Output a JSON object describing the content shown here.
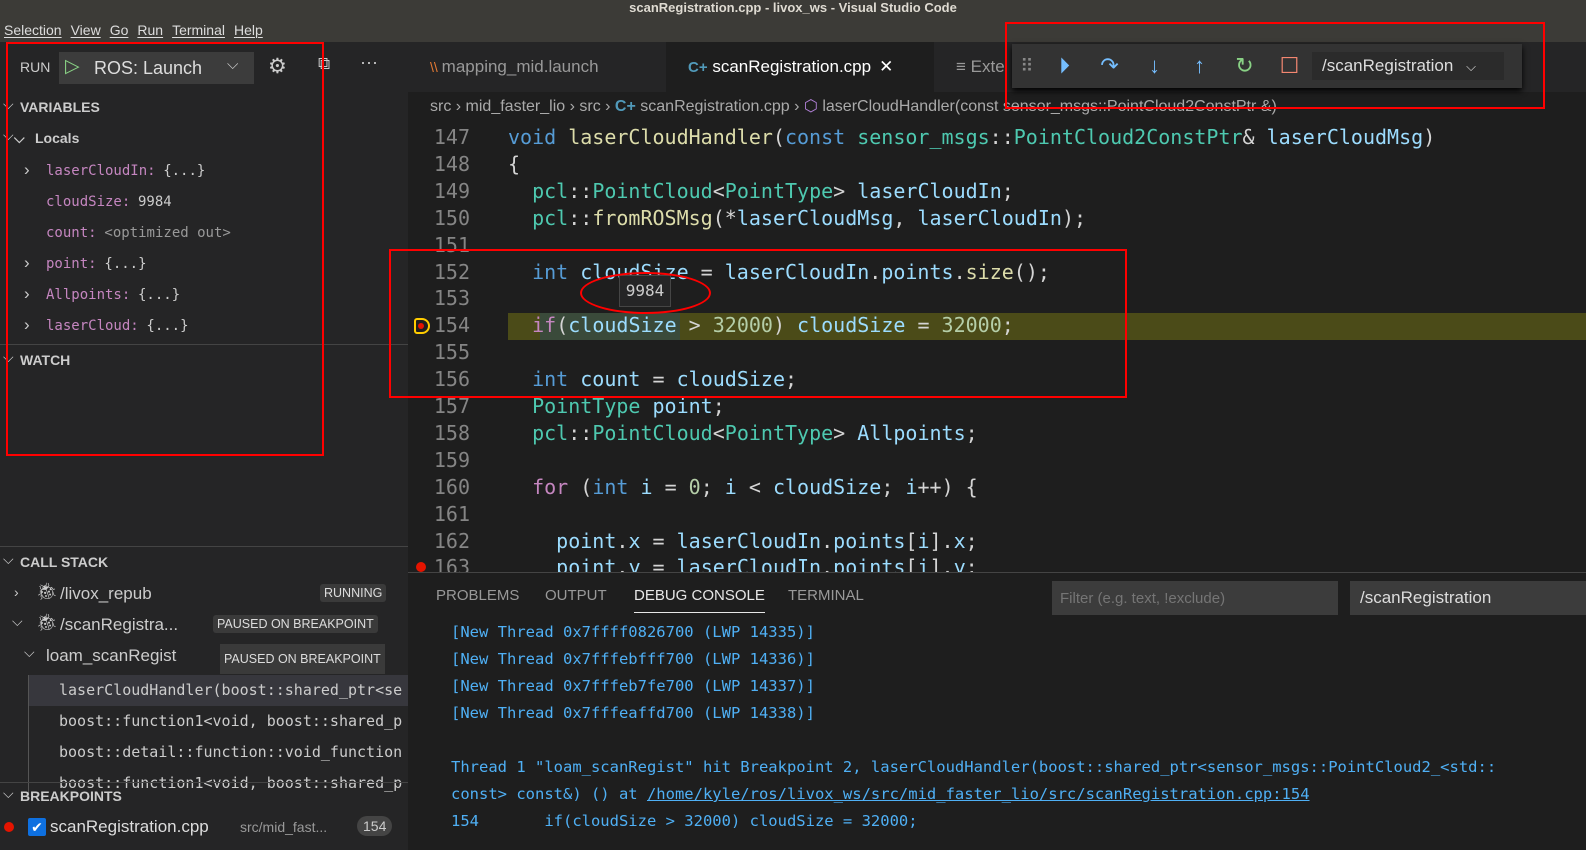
{
  "window": {
    "title": "scanRegistration.cpp - livox_ws - Visual Studio Code"
  },
  "menu": [
    "Selection",
    "View",
    "Go",
    "Run",
    "Terminal",
    "Help"
  ],
  "run": {
    "label": "RUN",
    "config": "ROS: Launch"
  },
  "variables": {
    "title": "VARIABLES",
    "scope": "Locals",
    "items": [
      {
        "name": "laserCloudIn:",
        "value": "{...}",
        "expandable": true
      },
      {
        "name": "cloudSize:",
        "value": "9984",
        "expandable": false
      },
      {
        "name": "count:",
        "value": "<optimized out>",
        "expandable": false
      },
      {
        "name": "point:",
        "value": "{...}",
        "expandable": true
      },
      {
        "name": "Allpoints:",
        "value": "{...}",
        "expandable": true
      },
      {
        "name": "laserCloud:",
        "value": "{...}",
        "expandable": true
      }
    ]
  },
  "watch": {
    "title": "WATCH"
  },
  "callstack": {
    "title": "CALL STACK",
    "processes": [
      {
        "name": "/livox_repub",
        "status": "RUNNING"
      },
      {
        "name": "/scanRegistra...",
        "status": "PAUSED ON BREAKPOINT"
      }
    ],
    "thread": {
      "name": "loam_scanRegist",
      "status": "PAUSED ON BREAKPOINT"
    },
    "frames": [
      "laserCloudHandler(boost::shared_ptr<se",
      "boost::function1<void, boost::shared_p",
      "boost::detail::function::void_function",
      "boost::function1<void, boost::shared_p"
    ]
  },
  "breakpoints": {
    "title": "BREAKPOINTS",
    "items": [
      {
        "file": "scanRegistration.cpp",
        "path": "src/mid_fast...",
        "line": "154",
        "checked": true
      }
    ]
  },
  "tabs": [
    {
      "label": "mapping_mid.launch",
      "icon": "rss-icon"
    },
    {
      "label": "scanRegistration.cpp",
      "icon": "cpp-icon",
      "active": true
    },
    {
      "label": "Exte",
      "icon": "list-icon"
    }
  ],
  "debug_toolbar": {
    "buttons": [
      "continue",
      "step-over",
      "step-into",
      "step-out",
      "restart",
      "stop"
    ],
    "session": "/scanRegistration"
  },
  "breadcrumb": [
    "src",
    "mid_faster_lio",
    "src",
    "scanRegistration.cpp",
    "laserCloudHandler(const sensor_msgs::PointCloud2ConstPtr &)"
  ],
  "hover_value": "9984",
  "current_line": "154",
  "code": [
    {
      "n": "147",
      "t": [
        [
          "kw",
          "void "
        ],
        [
          "fn",
          "laserCloudHandler"
        ],
        [
          "pl",
          "("
        ],
        [
          "kw",
          "const "
        ],
        [
          "ty",
          "sensor_msgs"
        ],
        [
          "pl",
          "::"
        ],
        [
          "ty",
          "PointCloud2ConstPtr"
        ],
        [
          "pl",
          "& "
        ],
        [
          "va",
          "laserCloudMsg"
        ],
        [
          "pl",
          ")"
        ]
      ]
    },
    {
      "n": "148",
      "t": [
        [
          "pl",
          "{"
        ]
      ]
    },
    {
      "n": "149",
      "t": [
        [
          "pl",
          "  "
        ],
        [
          "ty",
          "pcl"
        ],
        [
          "pl",
          "::"
        ],
        [
          "ty",
          "PointCloud"
        ],
        [
          "pl",
          "<"
        ],
        [
          "ty",
          "PointType"
        ],
        [
          "pl",
          "> "
        ],
        [
          "va",
          "laserCloudIn"
        ],
        [
          "pl",
          ";"
        ]
      ]
    },
    {
      "n": "150",
      "t": [
        [
          "pl",
          "  "
        ],
        [
          "ty",
          "pcl"
        ],
        [
          "pl",
          "::"
        ],
        [
          "fn",
          "fromROSMsg"
        ],
        [
          "pl",
          "(*"
        ],
        [
          "va",
          "laserCloudMsg"
        ],
        [
          "pl",
          ", "
        ],
        [
          "va",
          "laserCloudIn"
        ],
        [
          "pl",
          ");"
        ]
      ]
    },
    {
      "n": "151",
      "t": []
    },
    {
      "n": "152",
      "t": [
        [
          "pl",
          "  "
        ],
        [
          "kw",
          "int "
        ],
        [
          "va",
          "cloudSize"
        ],
        [
          "pl",
          " = "
        ],
        [
          "va",
          "laserCloudIn"
        ],
        [
          "pl",
          "."
        ],
        [
          "va",
          "points"
        ],
        [
          "pl",
          "."
        ],
        [
          "fn",
          "size"
        ],
        [
          "pl",
          "();"
        ]
      ]
    },
    {
      "n": "153",
      "t": []
    },
    {
      "n": "154",
      "t": [
        [
          "pl",
          "  "
        ],
        [
          "ct",
          "if"
        ],
        [
          "pl",
          "("
        ],
        [
          "va",
          "cloudSize"
        ],
        [
          "pl",
          " > "
        ],
        [
          "nu",
          "32000"
        ],
        [
          "pl",
          ") "
        ],
        [
          "va",
          "cloudSize"
        ],
        [
          "pl",
          " = "
        ],
        [
          "nu",
          "32000"
        ],
        [
          "pl",
          ";"
        ]
      ]
    },
    {
      "n": "155",
      "t": []
    },
    {
      "n": "156",
      "t": [
        [
          "pl",
          "  "
        ],
        [
          "kw",
          "int "
        ],
        [
          "va",
          "count"
        ],
        [
          "pl",
          " = "
        ],
        [
          "va",
          "cloudSize"
        ],
        [
          "pl",
          ";"
        ]
      ]
    },
    {
      "n": "157",
      "t": [
        [
          "pl",
          "  "
        ],
        [
          "ty",
          "PointType "
        ],
        [
          "va",
          "point"
        ],
        [
          "pl",
          ";"
        ]
      ]
    },
    {
      "n": "158",
      "t": [
        [
          "pl",
          "  "
        ],
        [
          "ty",
          "pcl"
        ],
        [
          "pl",
          "::"
        ],
        [
          "ty",
          "PointCloud"
        ],
        [
          "pl",
          "<"
        ],
        [
          "ty",
          "PointType"
        ],
        [
          "pl",
          "> "
        ],
        [
          "va",
          "Allpoints"
        ],
        [
          "pl",
          ";"
        ]
      ]
    },
    {
      "n": "159",
      "t": []
    },
    {
      "n": "160",
      "t": [
        [
          "pl",
          "  "
        ],
        [
          "ct",
          "for "
        ],
        [
          "pl",
          "("
        ],
        [
          "kw",
          "int "
        ],
        [
          "va",
          "i"
        ],
        [
          "pl",
          " = "
        ],
        [
          "nu",
          "0"
        ],
        [
          "pl",
          "; "
        ],
        [
          "va",
          "i"
        ],
        [
          "pl",
          " < "
        ],
        [
          "va",
          "cloudSize"
        ],
        [
          "pl",
          "; "
        ],
        [
          "va",
          "i"
        ],
        [
          "pl",
          "++) {"
        ]
      ]
    },
    {
      "n": "161",
      "t": []
    },
    {
      "n": "162",
      "t": [
        [
          "pl",
          "    "
        ],
        [
          "va",
          "point"
        ],
        [
          "pl",
          "."
        ],
        [
          "va",
          "x"
        ],
        [
          "pl",
          " = "
        ],
        [
          "va",
          "laserCloudIn"
        ],
        [
          "pl",
          "."
        ],
        [
          "va",
          "points"
        ],
        [
          "pl",
          "["
        ],
        [
          "va",
          "i"
        ],
        [
          "pl",
          "]."
        ],
        [
          "va",
          "x"
        ],
        [
          "pl",
          ";"
        ]
      ]
    },
    {
      "n": "163",
      "t": [
        [
          "pl",
          "    "
        ],
        [
          "va",
          "point"
        ],
        [
          "pl",
          "."
        ],
        [
          "va",
          "y"
        ],
        [
          "pl",
          " = "
        ],
        [
          "va",
          "laserCloudIn"
        ],
        [
          "pl",
          "."
        ],
        [
          "va",
          "points"
        ],
        [
          "pl",
          "["
        ],
        [
          "va",
          "i"
        ],
        [
          "pl",
          "]."
        ],
        [
          "va",
          "y"
        ],
        [
          "pl",
          ";"
        ]
      ]
    }
  ],
  "panel": {
    "tabs": [
      "PROBLEMS",
      "OUTPUT",
      "DEBUG CONSOLE",
      "TERMINAL"
    ],
    "active": "DEBUG CONSOLE",
    "filter_placeholder": "Filter (e.g. text, !exclude)",
    "session": "/scanRegistration",
    "lines": [
      "[New Thread 0x7ffff0826700 (LWP 14335)]",
      "[New Thread 0x7fffebfff700 (LWP 14336)]",
      "[New Thread 0x7fffeb7fe700 (LWP 14337)]",
      "[New Thread 0x7fffeaffd700 (LWP 14338)]",
      "",
      "Thread 1 \"loam_scanRegist\" hit Breakpoint 2, laserCloudHandler(boost::shared_ptr<sensor_msgs::PointCloud2_<std::"
    ],
    "line_at_prefix": "const> const&) () at ",
    "line_link": "/home/kyle/ros/livox_ws/src/mid_faster_lio/src/scanRegistration.cpp:154",
    "last_line": "154       if(cloudSize > 32000) cloudSize = 32000;"
  },
  "colors": {
    "current_line": "#4b4b18",
    "annotation": "#ff0000",
    "console_text": "#4fb0f5"
  }
}
